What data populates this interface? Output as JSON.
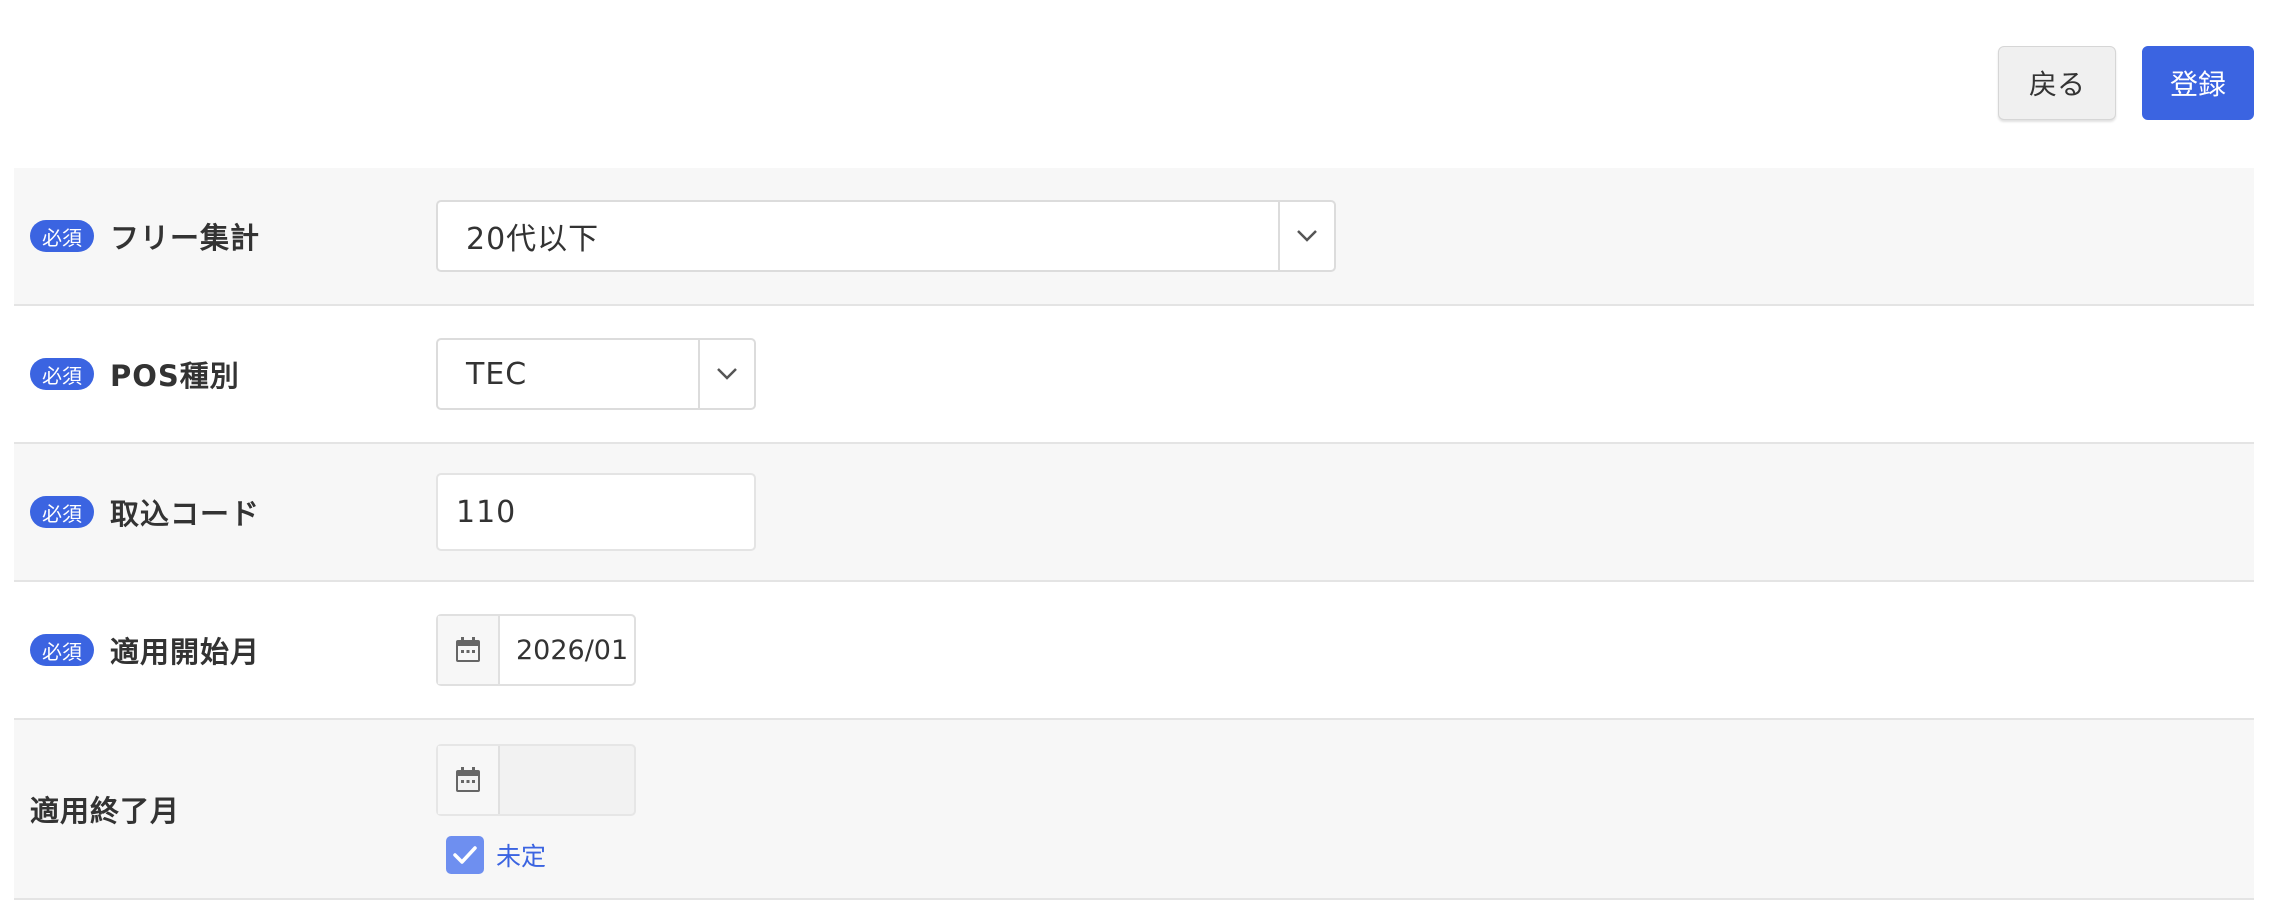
{
  "toolbar": {
    "back_label": "戻る",
    "submit_label": "登録"
  },
  "colors": {
    "accent": "#3b64e1",
    "row_shade": "#f7f7f7",
    "checkbox": "#6e8ff0"
  },
  "form": {
    "required_badge": "必須",
    "free_aggregate": {
      "label": "フリー集計",
      "value": "20代以下",
      "icon": "chevron-down-icon"
    },
    "pos_type": {
      "label": "POS種別",
      "value": "TEC",
      "icon": "chevron-down-icon"
    },
    "import_code": {
      "label": "取込コード",
      "value": "110"
    },
    "start_month": {
      "label": "適用開始月",
      "value": "2026/01",
      "icon": "calendar-icon"
    },
    "end_month": {
      "label": "適用終了月",
      "value": "",
      "icon": "calendar-icon",
      "undetermined_label": "未定",
      "undetermined_checked": true
    }
  }
}
